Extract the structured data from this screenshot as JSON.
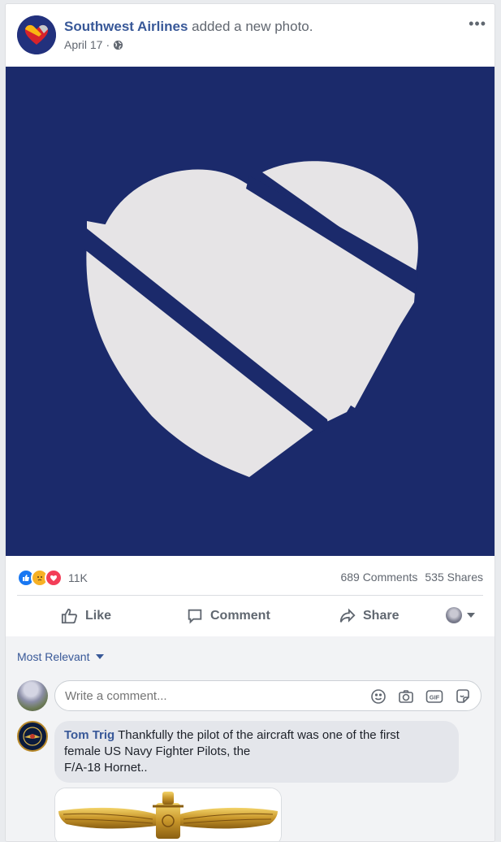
{
  "post": {
    "page_name": "Southwest Airlines",
    "action_text": "added a new photo.",
    "date": "April 17",
    "separator": "·",
    "more_label": "•••"
  },
  "stats": {
    "reactions_count": "11K",
    "comments": "689 Comments",
    "shares": "535 Shares"
  },
  "actions": {
    "like": "Like",
    "comment": "Comment",
    "share": "Share"
  },
  "comments": {
    "sort_label": "Most Relevant",
    "input_placeholder": "Write a comment...",
    "first": {
      "author": "Tom Trig",
      "text_line1": "Thankfully the pilot of the aircraft was one of the first",
      "text_line2": "female US Navy Fighter Pilots, the",
      "text_line3": "F/A-18 Hornet.."
    }
  },
  "colors": {
    "brand_blue": "#385898",
    "photo_bg": "#1b2a6b",
    "heart": "#e6e4e6"
  },
  "icons": [
    "globe-icon",
    "like-icon",
    "comment-icon",
    "share-icon",
    "emoji-icon",
    "camera-icon",
    "gif-icon",
    "sticker-icon"
  ]
}
